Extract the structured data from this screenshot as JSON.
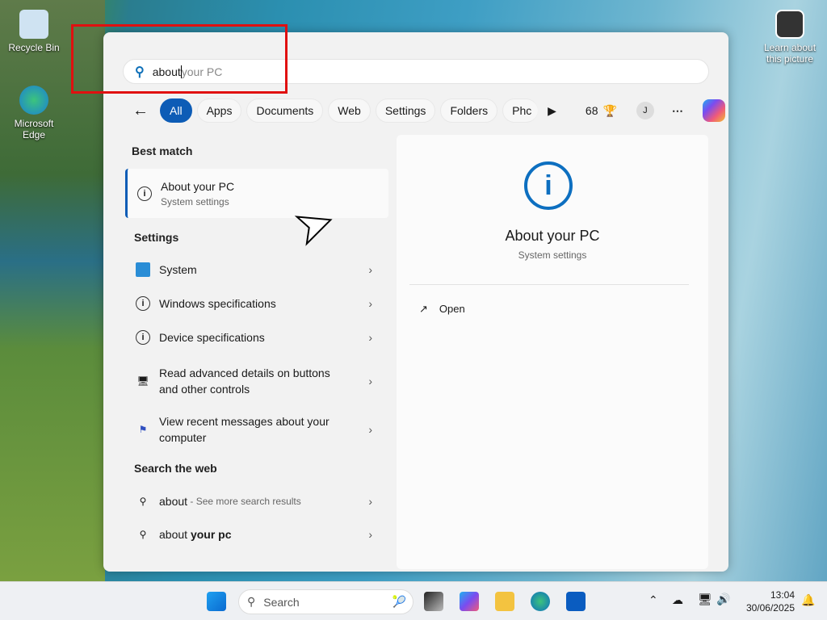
{
  "desktop": {
    "icons": [
      {
        "label": "Recycle Bin"
      },
      {
        "label": "Microsoft Edge"
      }
    ],
    "learn": "Learn about this picture"
  },
  "search": {
    "typed": "about",
    "hint": " your PC"
  },
  "chips": [
    "All",
    "Apps",
    "Documents",
    "Web",
    "Settings",
    "Folders",
    "Phc"
  ],
  "points": "68",
  "avatar": "J",
  "best_match": {
    "heading": "Best match",
    "title": "About your PC",
    "subtitle": "System settings"
  },
  "settings": {
    "heading": "Settings",
    "items": [
      "System",
      "Windows specifications",
      "Device specifications",
      "Read advanced details on buttons and other controls",
      "View recent messages about your computer"
    ]
  },
  "web": {
    "heading": "Search the web",
    "items": [
      {
        "main": "about",
        "suffix": " - See more search results"
      },
      {
        "main": "about ",
        "bold": "your pc"
      }
    ]
  },
  "preview": {
    "title": "About your PC",
    "subtitle": "System settings",
    "open": "Open"
  },
  "taskbar": {
    "search": "Search",
    "time": "13:04",
    "date": "30/06/2025"
  },
  "colors": {
    "accent": "#0d5cb6",
    "highlight": "#e01010"
  }
}
